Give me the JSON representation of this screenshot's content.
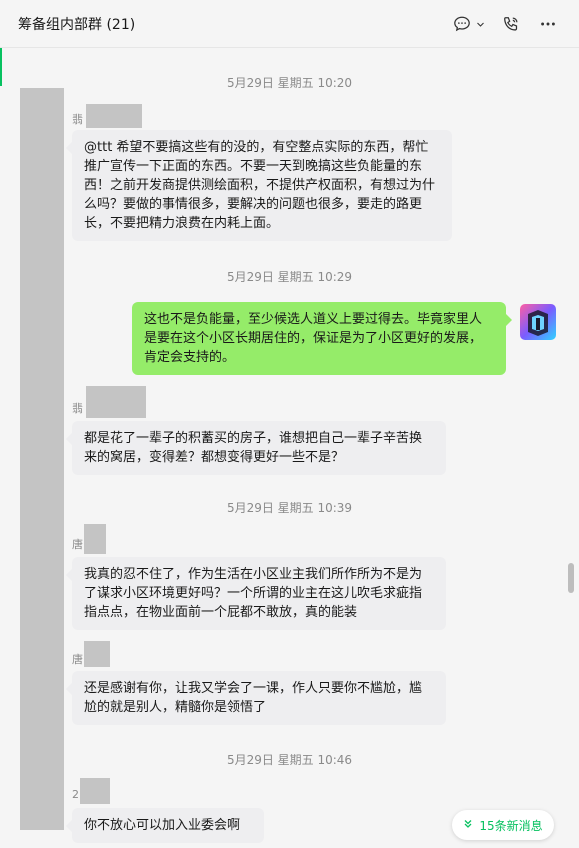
{
  "header": {
    "title": "筹备组内部群 (21)"
  },
  "messages": [
    {
      "type": "time",
      "text": "5月29日 星期五 10:20"
    },
    {
      "type": "in",
      "sender": "翡",
      "text": "@ttt 希望不要搞这些有的没的，有空整点实际的东西，帮忙推广宣传一下正面的东西。不要一天到晚搞这些负能量的东西！之前开发商提供测绘面积，不提供产权面积，有想过为什么吗？要做的事情很多，要解决的问题也很多，要走的路更长，不要把精力浪费在内耗上面。"
    },
    {
      "type": "time",
      "text": "5月29日 星期五 10:29"
    },
    {
      "type": "out",
      "text": "这也不是负能量，至少候选人道义上要过得去。毕竟家里人是要在这个小区长期居住的，保证是为了小区更好的发展，肯定会支持的。"
    },
    {
      "type": "in",
      "sender": "翡",
      "text": "都是花了一辈子的积蓄买的房子，谁想把自己一辈子辛苦换来的窝居，变得差？都想变得更好一些不是？"
    },
    {
      "type": "time",
      "text": "5月29日 星期五 10:39"
    },
    {
      "type": "in",
      "sender": "唐",
      "text": "我真的忍不住了，作为生活在小区业主我们所作所为不是为了谋求小区环境更好吗？一个所谓的业主在这儿吹毛求疵指指点点，在物业面前一个屁都不敢放，真的能装"
    },
    {
      "type": "in",
      "sender": "唐",
      "text": "还是感谢有你，让我又学会了一课，作人只要你不尴尬，尴尬的就是别人，精髓你是领悟了"
    },
    {
      "type": "time",
      "text": "5月29日 星期五 10:46"
    },
    {
      "type": "in",
      "sender": "2",
      "text": "你不放心可以加入业委会啊"
    }
  ],
  "new_messages": {
    "label": "15条新消息"
  },
  "icons": {
    "chat": "chat-bubble-icon",
    "chevron": "chevron-down-icon",
    "call": "phone-call-icon",
    "more": "more-dots-icon"
  },
  "colors": {
    "accent": "#07c160",
    "bubble_out": "#95ec69",
    "bubble_in": "#eeeef0",
    "background": "#f5f5f5"
  }
}
